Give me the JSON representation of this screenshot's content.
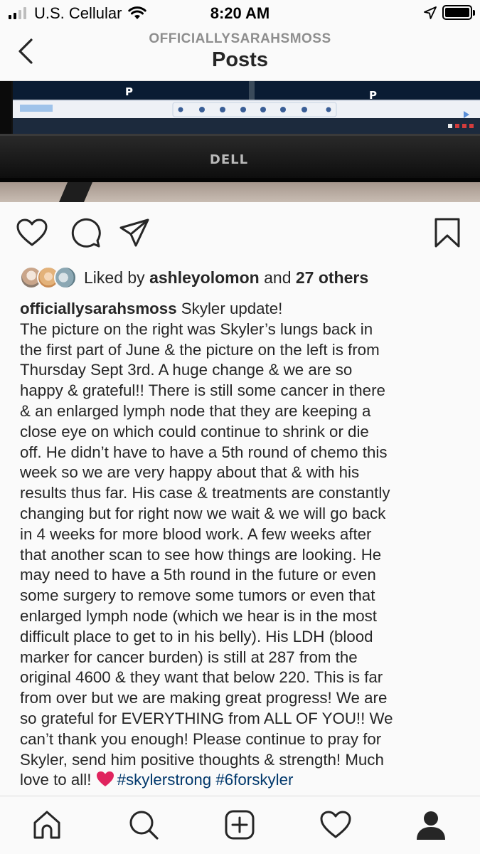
{
  "status_bar": {
    "carrier": "U.S. Cellular",
    "time": "8:20 AM",
    "signal_bars": 4,
    "signal_bars_filled": 2
  },
  "header": {
    "username": "OFFICIALLYSARAHSMOSS",
    "title": "Posts",
    "back_icon": "chevron-left-icon"
  },
  "photo": {
    "monitor_brand": "DELL",
    "screen_letter_left": "P",
    "screen_letter_right": "P"
  },
  "actions": {
    "like_icon": "heart-icon",
    "comment_icon": "comment-icon",
    "share_icon": "paper-plane-icon",
    "save_icon": "bookmark-icon"
  },
  "likes": {
    "prefix": "Liked by",
    "user": "ashleyolomon",
    "joiner": "and",
    "others": "27 others"
  },
  "caption": {
    "username": "officiallysarahsmoss",
    "first_line_text": " Skyler update!",
    "lines": [
      "The picture on the right was Skyler’s lungs back in",
      "the first part of June & the picture on the left is from",
      "Thursday Sept 3rd. A huge change & we are so",
      "happy & grateful!! There is still some cancer in there",
      "& an enlarged lymph node that they are keeping a",
      "close eye on which could continue to shrink or die",
      "off. He didn’t have to have a 5th round of chemo this",
      "week so we are very happy about that & with his",
      "results thus far. His case & treatments are constantly",
      "changing but for right now we wait & we will go back",
      "in 4 weeks for more blood work. A few weeks after",
      "that another scan to see how things are looking. He",
      "may need to have a 5th round in the future or even",
      "some surgery to remove some tumors or even that",
      "enlarged lymph node (which we hear is in the most",
      "difficult place to get to in his belly). His LDH (blood",
      "marker for cancer burden) is still at 287 from the",
      "original 4600 & they want that below 220. This is far",
      "from over but we are making great progress! We are",
      "so grateful for EVERYTHING from ALL OF YOU!! We",
      "can’t thank you enough! Please continue to pray for",
      "Skyler, send him positive thoughts & strength! Much"
    ],
    "last_line_text": "love to all!",
    "hashtags": [
      "#skylerstrong",
      "#6forskyler"
    ]
  },
  "bottom_nav": [
    {
      "name": "home",
      "icon": "home-icon"
    },
    {
      "name": "search",
      "icon": "search-icon"
    },
    {
      "name": "new-post",
      "icon": "plus-square-icon"
    },
    {
      "name": "activity",
      "icon": "heart-icon"
    },
    {
      "name": "profile",
      "icon": "profile-icon"
    }
  ],
  "colors": {
    "background": "#fafafa",
    "text": "#262626",
    "muted": "#8e8e8e",
    "hashtag": "#00376b",
    "heart_emoji": "#e0245e"
  }
}
